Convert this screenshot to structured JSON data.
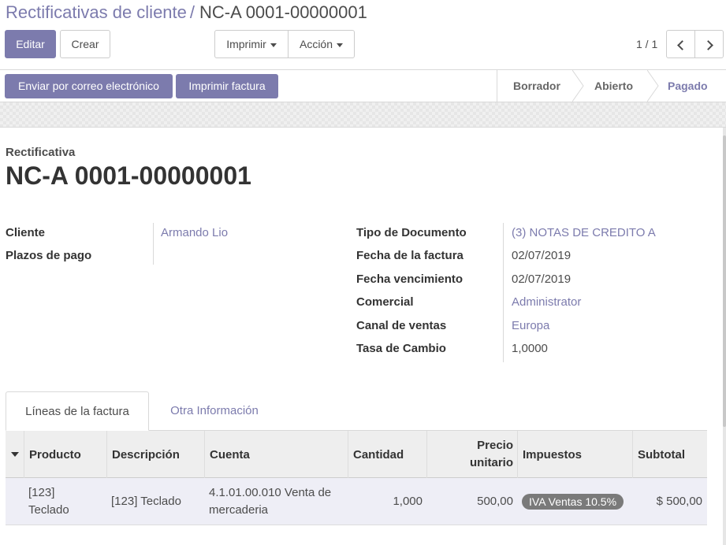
{
  "breadcrumb": {
    "parent": "Rectificativas de cliente",
    "separator": "/",
    "current": "NC-A 0001-00000001"
  },
  "toolbar": {
    "edit_label": "Editar",
    "create_label": "Crear",
    "print_label": "Imprimir",
    "action_label": "Acción"
  },
  "pager": {
    "value": "1 / 1"
  },
  "statusbar": {
    "send_email_label": "Enviar por correo electrónico",
    "print_invoice_label": "Imprimir factura",
    "states": [
      "Borrador",
      "Abierto",
      "Pagado"
    ],
    "active_state": "Pagado"
  },
  "document": {
    "type_label": "Rectificativa",
    "name": "NC-A 0001-00000001"
  },
  "fields_left": {
    "customer_label": "Cliente",
    "customer_value": "Armando Lio",
    "payment_terms_label": "Plazos de pago",
    "payment_terms_value": ""
  },
  "fields_right": {
    "doc_type_label": "Tipo de Documento",
    "doc_type_value": "(3) NOTAS DE CREDITO A",
    "invoice_date_label": "Fecha de la factura",
    "invoice_date_value": "02/07/2019",
    "due_date_label": "Fecha vencimiento",
    "due_date_value": "02/07/2019",
    "salesperson_label": "Comercial",
    "salesperson_value": "Administrator",
    "sales_channel_label": "Canal de ventas",
    "sales_channel_value": "Europa",
    "exchange_rate_label": "Tasa de Cambio",
    "exchange_rate_value": "1,0000"
  },
  "tabs": [
    {
      "label": "Líneas de la factura",
      "active": true
    },
    {
      "label": "Otra Información",
      "active": false
    }
  ],
  "invoice_lines": {
    "columns": {
      "product": "Producto",
      "description": "Descripción",
      "account": "Cuenta",
      "quantity": "Cantidad",
      "unit_price": "Precio unitario",
      "taxes": "Impuestos",
      "subtotal": "Subtotal"
    },
    "rows": [
      {
        "product": "[123] Teclado",
        "description": "[123] Teclado",
        "account": "4.1.01.00.010 Venta de mercaderia",
        "quantity": "1,000",
        "unit_price": "500,00",
        "tax": "IVA Ventas 10.5%",
        "subtotal": "$ 500,00"
      }
    ]
  },
  "colors": {
    "accent": "#7c7bad",
    "text": "#4c4c4c",
    "tax_badge": "#7a7a7a"
  }
}
